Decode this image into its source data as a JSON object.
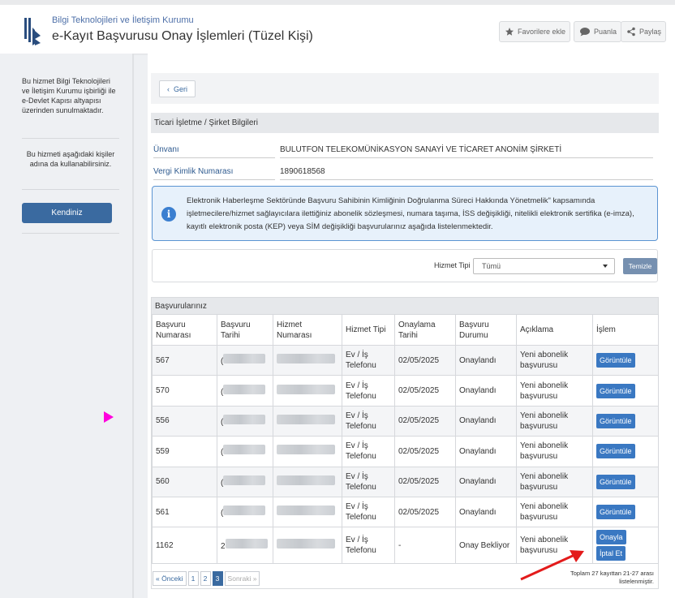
{
  "header": {
    "institution": "Bilgi Teknolojileri ve İletişim Kurumu",
    "title": "e-Kayıt Başvurusu Onay İşlemleri (Tüzel Kişi)",
    "favorites_label": "Favorilere ekle",
    "rate_label": "Puanla",
    "share_label": "Paylaş"
  },
  "sidebar": {
    "info_text": "Bu hizmet Bilgi Teknolojileri ve İletişim Kurumu işbirliği ile e-Devlet Kapısı altyapısı üzerinden sunulmaktadır.",
    "usage_text": "Bu hizmeti aşağıdaki kişiler adına da kullanabilirsiniz.",
    "self_button": "Kendiniz"
  },
  "main": {
    "back_label": "Geri",
    "section_title": "Ticari İşletme / Şirket Bilgileri",
    "fields": [
      {
        "label": "Ünvanı",
        "value": "BULUTFON TELEKOMÜNİKASYON SANAYİ VE TİCARET ANONİM ŞİRKETİ"
      },
      {
        "label": "Vergi Kimlik Numarası",
        "value": "1890618568"
      }
    ],
    "alert_text": "Elektronik Haberleşme Sektöründe Başvuru Sahibinin Kimliğinin Doğrulanma Süreci Hakkında Yönetmelik\" kapsamında işletmecilere/hizmet sağlayıcılara ilettiğiniz abonelik sözleşmesi, numara taşıma, İSS değişikliği, nitelikli elektronik sertifika (e-imza), kayıtlı elektronik posta (KEP) veya SİM değişikliği başvurularınız aşağıda listelenmektedir.",
    "filter": {
      "label": "Hizmet Tipi",
      "selected": "Tümü",
      "clear_label": "Temizle"
    },
    "table": {
      "title": "Başvurularınız",
      "headers": [
        "Başvuru Numarası",
        "Başvuru Tarihi",
        "Hizmet Numarası",
        "Hizmet Tipi",
        "Onaylama Tarihi",
        "Başvuru Durumu",
        "Açıklama",
        "İşlem"
      ],
      "rows": [
        {
          "no": "567",
          "date_prefix": "(",
          "type": "Ev / İş Telefonu",
          "approval_date": "02/05/2025",
          "status": "Onaylandı",
          "desc": "Yeni abonelik başvurusu",
          "action": "Görüntüle"
        },
        {
          "no": "570",
          "date_prefix": "(",
          "type": "Ev / İş Telefonu",
          "approval_date": "02/05/2025",
          "status": "Onaylandı",
          "desc": "Yeni abonelik başvurusu",
          "action": "Görüntüle"
        },
        {
          "no": "556",
          "date_prefix": "(",
          "type": "Ev / İş Telefonu",
          "approval_date": "02/05/2025",
          "status": "Onaylandı",
          "desc": "Yeni abonelik başvurusu",
          "action": "Görüntüle"
        },
        {
          "no": "559",
          "date_prefix": "(",
          "type": "Ev / İş Telefonu",
          "approval_date": "02/05/2025",
          "status": "Onaylandı",
          "desc": "Yeni abonelik başvurusu",
          "action": "Görüntüle"
        },
        {
          "no": "560",
          "date_prefix": "(",
          "type": "Ev / İş Telefonu",
          "approval_date": "02/05/2025",
          "status": "Onaylandı",
          "desc": "Yeni abonelik başvurusu",
          "action": "Görüntüle"
        },
        {
          "no": "561",
          "date_prefix": "(",
          "type": "Ev / İş Telefonu",
          "approval_date": "02/05/2025",
          "status": "Onaylandı",
          "desc": "Yeni abonelik başvurusu",
          "action": "Görüntüle"
        },
        {
          "no": "1162",
          "date_prefix": "2",
          "type": "Ev / İş Telefonu",
          "approval_date": "-",
          "status": "Onay Bekliyor",
          "desc": "Yeni abonelik başvurusu",
          "action_approve": "Onayla",
          "action_cancel": "İptal Et"
        }
      ]
    },
    "pagination": {
      "prev": "« Önceki",
      "pages": [
        "1",
        "2",
        "3"
      ],
      "current": "3",
      "next": "Sonraki »",
      "summary": "Toplam 27 kayıttan 21-27 arası listelenmiştir."
    }
  },
  "colors": {
    "accent": "#3a6aa0",
    "button": "#3a78c2",
    "annotation_pink": "#ff00dd",
    "annotation_red": "#e31b1b"
  }
}
